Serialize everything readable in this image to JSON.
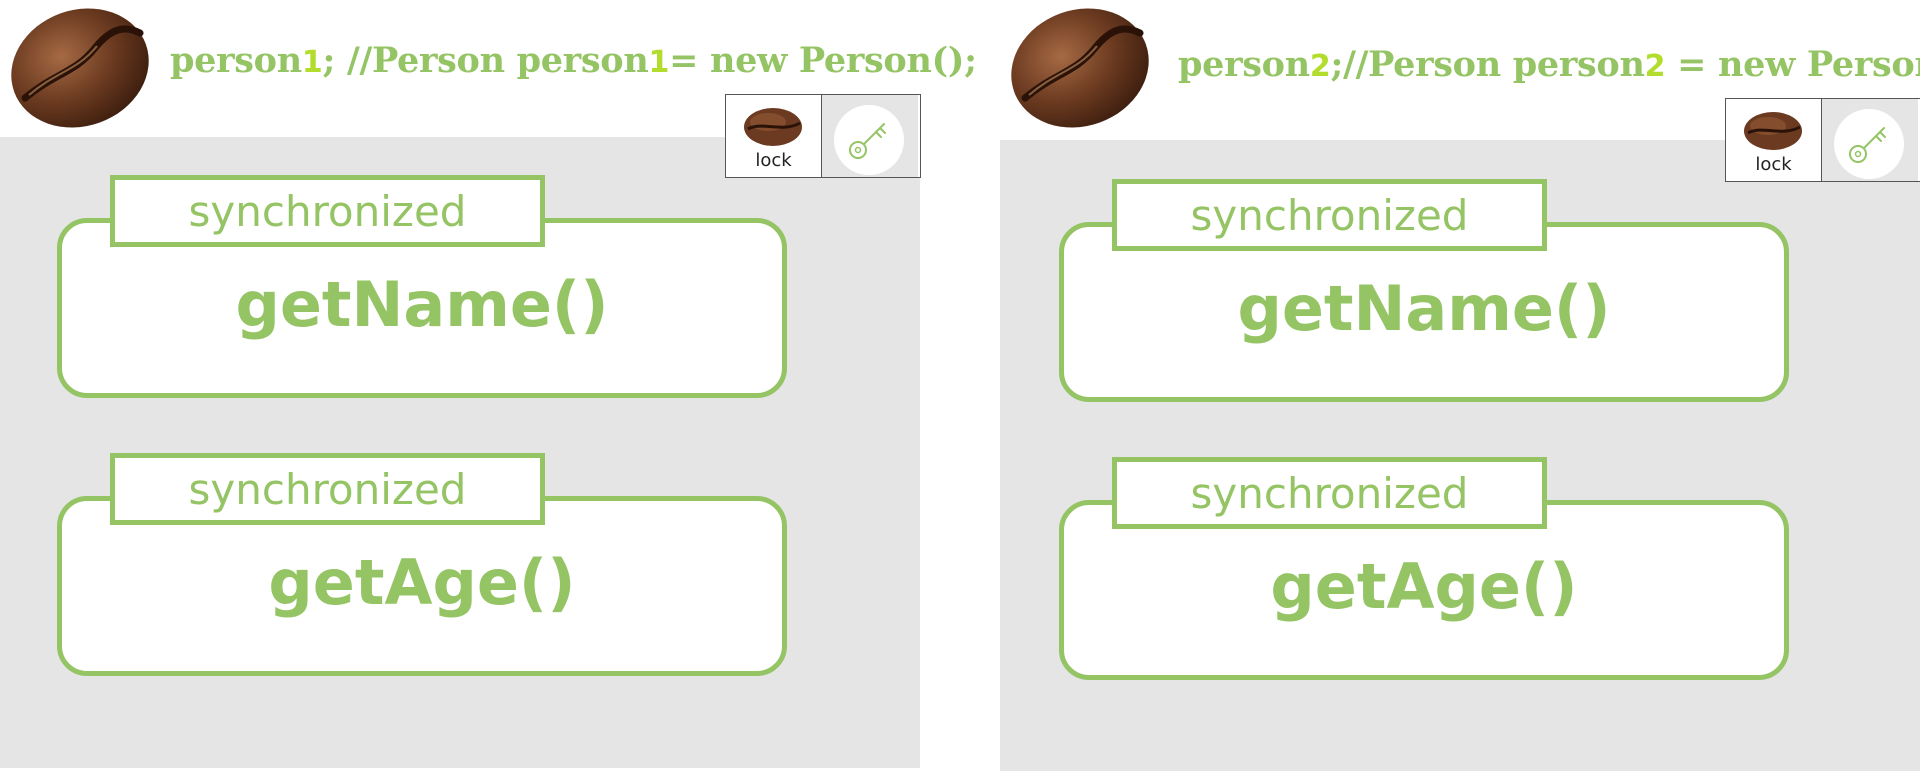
{
  "colors": {
    "accent": "#94c464",
    "highlight": "#b3dd2c",
    "panel_bg": "#e5e5e5"
  },
  "panels": [
    {
      "object_name": "person",
      "object_num": "1",
      "sep": "; ",
      "comment_pre": "//Person person",
      "comment_num": "1",
      "comment_post": "= new Person();",
      "lock_label": "lock",
      "methods": [
        {
          "modifier": "synchronized",
          "name": "getName()"
        },
        {
          "modifier": "synchronized",
          "name": "getAge()"
        }
      ]
    },
    {
      "object_name": "person",
      "object_num": "2",
      "sep": ";",
      "comment_pre": "//Person person",
      "comment_num": "2",
      "comment_post": " = new Person();",
      "lock_label": "lock",
      "methods": [
        {
          "modifier": "synchronized",
          "name": "getName()"
        },
        {
          "modifier": "synchronized",
          "name": "getAge()"
        }
      ]
    }
  ],
  "icons": [
    "coffee-bean-icon",
    "key-icon"
  ]
}
